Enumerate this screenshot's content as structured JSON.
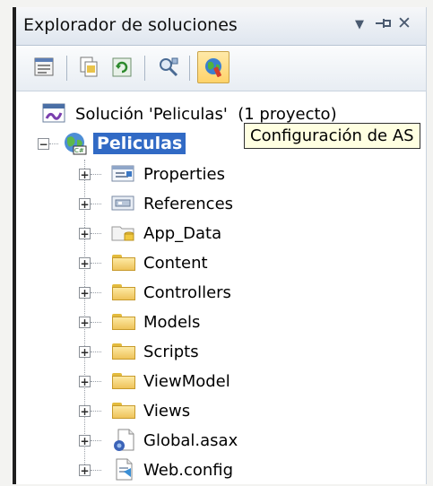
{
  "panel": {
    "title": "Explorador de soluciones",
    "controls": {
      "dropdown": "▼",
      "pin": "⊣",
      "close": "✕"
    }
  },
  "toolbar": {
    "buttons": [
      {
        "icon": "properties-icon"
      },
      {
        "icon": "show-all-files-icon"
      },
      {
        "icon": "refresh-icon"
      },
      {
        "icon": "view-class-diagram-icon"
      },
      {
        "icon": "asp-net-configuration-icon"
      }
    ]
  },
  "tree": {
    "solution": "Solución 'Peliculas'  (1 proyecto)",
    "project": "Peliculas",
    "tooltip": "Configuración de AS",
    "items": [
      {
        "label": "Properties",
        "icon": "properties-folder-icon"
      },
      {
        "label": "References",
        "icon": "references-icon"
      },
      {
        "label": "App_Data",
        "icon": "app-data-folder-icon"
      },
      {
        "label": "Content",
        "icon": "folder-icon"
      },
      {
        "label": "Controllers",
        "icon": "folder-icon"
      },
      {
        "label": "Models",
        "icon": "folder-icon"
      },
      {
        "label": "Scripts",
        "icon": "folder-icon"
      },
      {
        "label": "ViewModel",
        "icon": "folder-icon"
      },
      {
        "label": "Views",
        "icon": "folder-icon"
      },
      {
        "label": "Global.asax",
        "icon": "global-asax-file-icon"
      },
      {
        "label": "Web.config",
        "icon": "web-config-file-icon"
      }
    ]
  }
}
